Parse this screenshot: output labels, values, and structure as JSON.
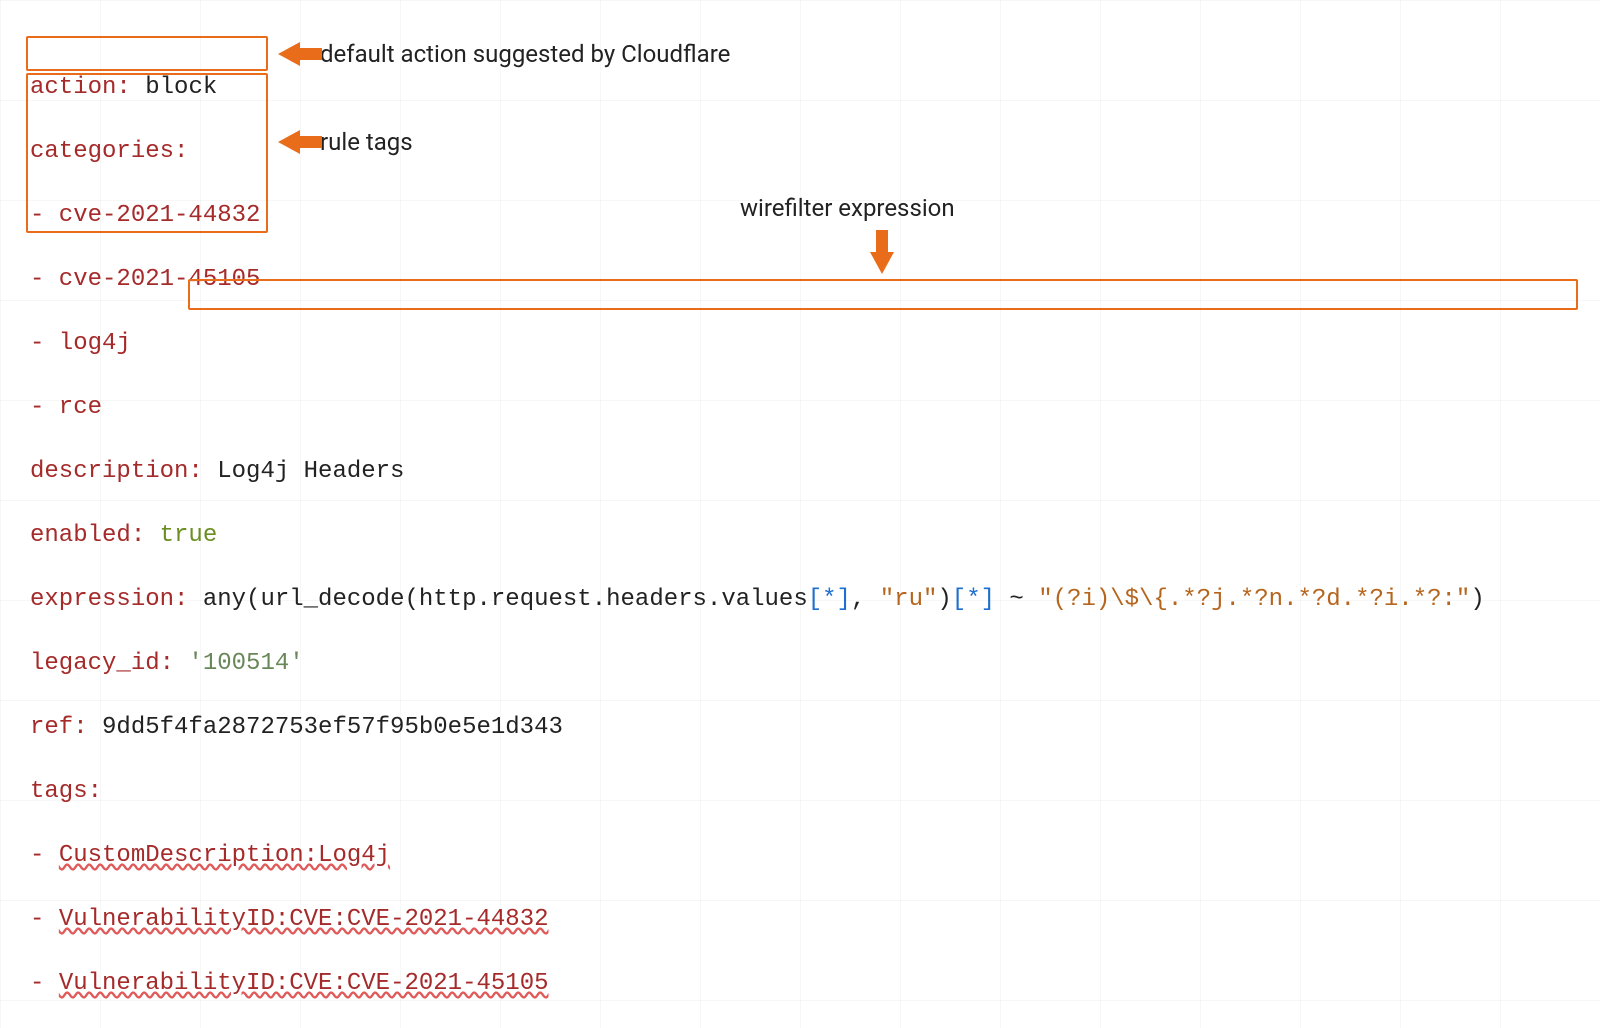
{
  "yaml": {
    "action_key": "action:",
    "action_val": " block",
    "categories_key": "categories:",
    "cat_items": [
      "- cve-2021-44832",
      "- cve-2021-45105",
      "- log4j",
      "- rce"
    ],
    "description_key": "description:",
    "description_val": " Log4j Headers",
    "enabled_key": "enabled:",
    "enabled_val": " true",
    "expression_key": "expression:",
    "expr_pre": " any(url_decode(http.request.headers.values",
    "expr_idx1": "[*]",
    "expr_mid1": ", ",
    "expr_ru": "\"ru\"",
    "expr_mid2": ")",
    "expr_idx2": "[*]",
    "expr_mid3": " ~ ",
    "expr_regex": "\"(?i)\\$\\{.*?j.*?n.*?d.*?i.*?:\"",
    "expr_end": ")",
    "legacy_key": "legacy_id:",
    "legacy_val": " '100514'",
    "ref_key": "ref:",
    "ref_val": " 9dd5f4fa2872753ef57f95b0e5e1d343",
    "tags_key": "tags:",
    "tag_items_prefix": "- ",
    "tag_items": [
      "CustomDescription:Log4j",
      "VulnerabilityID:CVE:CVE-2021-44832",
      "VulnerabilityID:CVE:CVE-2021-45105"
    ]
  },
  "annotations": {
    "action": "default action suggested by Cloudflare",
    "tags": "rule tags",
    "expression": "wirefilter expression"
  },
  "colors": {
    "highlight": "#e86c1a",
    "key": "#a52a2a"
  }
}
